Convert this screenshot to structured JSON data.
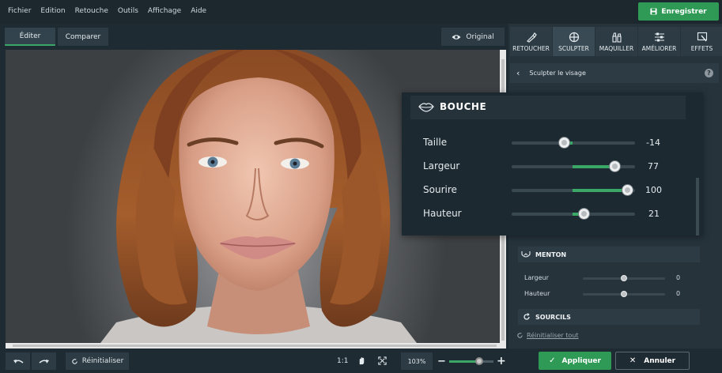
{
  "menu": {
    "items": [
      "Fichier",
      "Edition",
      "Retouche",
      "Outils",
      "Affichage",
      "Aide"
    ],
    "save_label": "Enregistrer"
  },
  "tabs": {
    "edit": "Éditer",
    "compare": "Comparer",
    "original": "Original"
  },
  "tools": [
    {
      "label": "RETOUCHER",
      "icon": "brush-icon"
    },
    {
      "label": "SCULPTER",
      "icon": "sculpt-icon"
    },
    {
      "label": "MAQUILLER",
      "icon": "makeup-icon"
    },
    {
      "label": "AMÉLIORER",
      "icon": "sliders-icon"
    },
    {
      "label": "EFFETS",
      "icon": "effects-icon"
    }
  ],
  "panel": {
    "subheader": "Sculpter le visage",
    "help": "?",
    "bouche": {
      "title": "BOUCHE",
      "sliders": [
        {
          "label": "Taille",
          "value": "-14",
          "level": -0.14
        },
        {
          "label": "Largeur",
          "value": "77",
          "level": 0.77
        },
        {
          "label": "Sourire",
          "value": "100",
          "level": 1.0
        },
        {
          "label": "Hauteur",
          "value": "21",
          "level": 0.21
        }
      ]
    },
    "menton": {
      "title": "MENTON",
      "sliders": [
        {
          "label": "Largeur",
          "value": "0"
        },
        {
          "label": "Hauteur",
          "value": "0"
        }
      ]
    },
    "sourcils": {
      "title": "SOURCILS"
    },
    "reset_all": "Réinitialiser tout"
  },
  "bottom": {
    "reset": "Réinitialiser",
    "ratio": "1:1",
    "zoom": "103%",
    "zoom_level": 0.68,
    "apply": "Appliquer",
    "cancel": "Annuler"
  },
  "colors": {
    "accent": "#3aa766",
    "save": "#2e9a55",
    "background": "#1f2b33"
  }
}
